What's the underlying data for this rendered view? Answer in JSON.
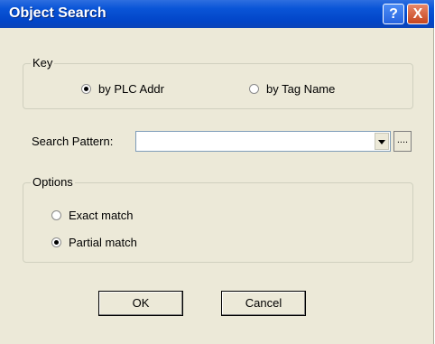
{
  "dialog": {
    "title": "Object Search",
    "help_glyph": "?",
    "close_glyph": "X"
  },
  "key_group": {
    "label": "Key",
    "options": [
      {
        "label": "by PLC Addr",
        "checked": true
      },
      {
        "label": "by Tag Name",
        "checked": false
      }
    ]
  },
  "search": {
    "label": "Search Pattern:",
    "value": "",
    "browse_label": "...."
  },
  "options_group": {
    "label": "Options",
    "options": [
      {
        "label": "Exact match",
        "checked": false
      },
      {
        "label": "Partial match",
        "checked": true
      }
    ]
  },
  "buttons": {
    "ok": "OK",
    "cancel": "Cancel"
  },
  "icons": {
    "help": "help-icon",
    "close": "close-icon",
    "dropdown": "chevron-down-icon"
  },
  "colors": {
    "titlebar": "#0a55d7",
    "dialog_background": "#ece9d8",
    "close_button": "#c6451e"
  }
}
